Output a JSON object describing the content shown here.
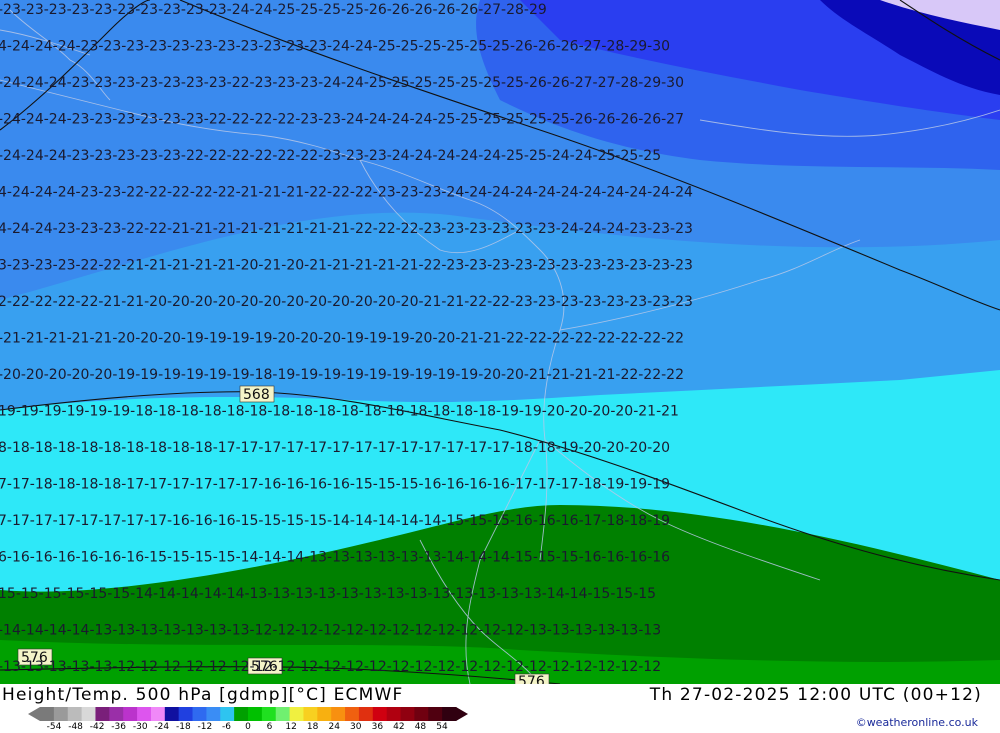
{
  "map": {
    "title": "Height/Temp. 500 hPa [gdmp][°C] ECMWF",
    "valid_time": "Th 27-02-2025 12:00 UTC (00+12)",
    "credit": "©weatheronline.co.uk",
    "height_labels": [
      "568",
      "576",
      "576",
      "576"
    ],
    "temperature_rows": [
      "-23-23-23-23-23-23-23-23-23-23-24-24-25-25-25-25-26-26-26-26-26-27-28-29",
      "4-24-24-24-23-23-23-23-23-23-23-23-23-23-23-24-24-25-25-25-25-25-25-26-26-26-27-28-29-30",
      "-24-24-24-23-23-23-23-23-23-23-22-23-23-23-24-24-25-25-25-25-25-25-25-26-26-27-27-28-29-30",
      "-24-24-24-23-23-23-23-23-23-22-22-22-22-23-23-24-24-24-24-25-25-25-25-25-25-26-26-26-26-27",
      "-24-24-24-23-23-23-23-23-22-22-22-22-22-22-23-23-23-24-24-24-24-24-25-25-24-24-25-25-25",
      "4-24-24-24-23-23-22-22-22-22-22-21-21-21-22-22-22-23-23-23-24-24-24-24-24-24-24-24-24-24-24",
      "4-24-24-23-23-23-22-22-21-21-21-21-21-21-21-21-22-22-22-23-23-23-23-23-23-24-24-24-23-23-23",
      "3-23-23-23-22-22-21-21-21-21-21-20-21-20-21-21-21-21-21-22-23-23-23-23-23-23-23-23-23-23-23",
      "2-22-22-22-22-21-21-20-20-20-20-20-20-20-20-20-20-20-20-21-21-22-22-23-23-23-23-23-23-23-23",
      "-21-21-21-21-21-20-20-20-19-19-19-19-20-20-20-19-19-19-20-20-21-21-22-22-22-22-22-22-22-22",
      "-20-20-20-20-20-19-19-19-19-19-19-18-19-19-19-19-19-19-19-19-19-20-20-21-21-21-21-22-22-22",
      "19-19-19-19-19-19-18-18-18-18-18-18-18-18-18-18-18-18-18-18-18-18-19-19-20-20-20-20-21-21",
      "8-18-18-18-18-18-18-18-18-18-17-17-17-17-17-17-17-17-17-17-17-17-17-18-18-19-20-20-20-20",
      "7-17-18-18-18-18-17-17-17-17-17-17-16-16-16-16-15-15-15-16-16-16-16-17-17-17-18-19-19-19",
      "7-17-17-17-17-17-17-17-16-16-16-15-15-15-15-14-14-14-14-14-15-15-15-16-16-16-17-18-18-19",
      "6-16-16-16-16-16-16-15-15-15-15-14-14-14-13-13-13-13-13-13-14-14-14-15-15-15-16-16-16-16",
      "15-15-15-15-15-15-14-14-14-14-14-13-13-13-13-13-13-13-13-13-13-13-13-13-14-14-15-15-15",
      "-14-14-14-14-13-13-13-13-13-13-13-12-12-12-12-12-12-12-12-12-12-12-12-13-13-13-13-13-13",
      "-13-13-13-13-13-12-12-12-12-12-12-12-12-12-12-12-12-12-12-12-12-12-12-12-12-12-12-12-12"
    ]
  },
  "legend": {
    "tick_labels": [
      "-54",
      "-48",
      "-42",
      "-36",
      "-30",
      "-24",
      "-18",
      "-12",
      "-6",
      "0",
      "6",
      "12",
      "18",
      "24",
      "30",
      "36",
      "42",
      "48",
      "54"
    ],
    "colors": [
      "#7a7a7a",
      "#9a9a9a",
      "#bbbbbb",
      "#d8d8d8",
      "#7a1f7a",
      "#9a2fa8",
      "#bb33cc",
      "#dd55ee",
      "#f088f8",
      "#1010a0",
      "#2040e0",
      "#2f6af0",
      "#3a8df5",
      "#2ec4f0",
      "#00a000",
      "#00c000",
      "#20e020",
      "#70f070",
      "#f0f040",
      "#f8d020",
      "#f8b010",
      "#f89010",
      "#f06010",
      "#e03010",
      "#d00010",
      "#b00010",
      "#900010",
      "#700010",
      "#500010",
      "#300010"
    ],
    "field_colors": {
      "navy": "#0a0ab8",
      "blue_dark": "#2a3ef0",
      "blue_mid": "#2f63ee",
      "blue_light": "#3a8aee",
      "blue_sky": "#38b0f2",
      "cyan": "#2ee8f8",
      "cyan_light": "#30f0ff",
      "green": "#008000",
      "green_mid": "#00a000"
    }
  }
}
